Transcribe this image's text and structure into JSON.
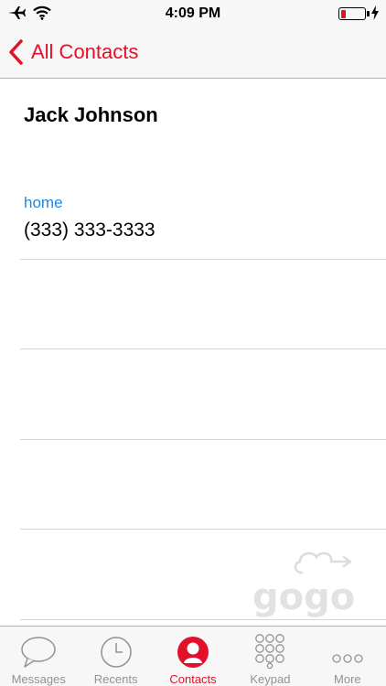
{
  "status_bar": {
    "time": "4:09 PM",
    "icons": [
      "airplane-icon",
      "wifi-icon",
      "battery-icon",
      "charging-bolt-icon"
    ]
  },
  "nav": {
    "back_label": "All Contacts"
  },
  "contact": {
    "name": "Jack Johnson",
    "phone_label": "home",
    "phone_number": "(333) 333-3333"
  },
  "watermark": {
    "text": "gogo"
  },
  "tabs": [
    {
      "label": "Messages",
      "icon": "messages-icon",
      "active": false
    },
    {
      "label": "Recents",
      "icon": "clock-icon",
      "active": false
    },
    {
      "label": "Contacts",
      "icon": "contacts-icon",
      "active": true
    },
    {
      "label": "Keypad",
      "icon": "keypad-icon",
      "active": false
    },
    {
      "label": "More",
      "icon": "more-icon",
      "active": false
    }
  ],
  "colors": {
    "accent": "#e3102a",
    "link_blue": "#1e88e5",
    "inactive_gray": "#929292",
    "bar_background": "#f7f7f7"
  }
}
